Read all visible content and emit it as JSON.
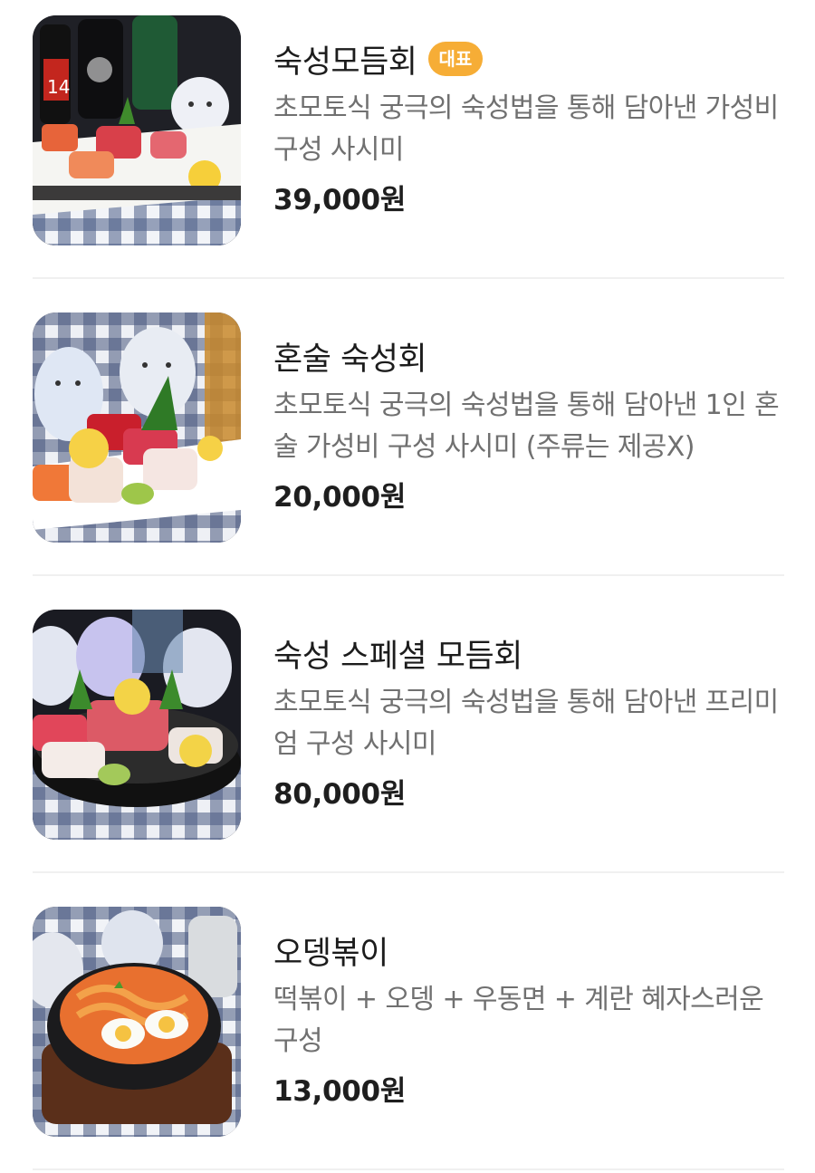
{
  "menu": {
    "items": [
      {
        "title": "숙성모듬회",
        "badge": "대표",
        "description": "초모토식 궁극의 숙성법을 통해 담아낸 가성비 구성 사시미",
        "price": "39,000원",
        "image": "sashimi-platter-photo",
        "image_label": "14"
      },
      {
        "title": "혼술 숙성회",
        "description": "초모토식 궁극의 숙성법을 통해 담아낸 1인 혼술 가성비 구성 사시미 (주류는 제공X)",
        "price": "20,000원",
        "image": "single-sashimi-plate-photo"
      },
      {
        "title": "숙성 스페셜 모듬회",
        "description": "초모토식 궁극의 숙성법을 통해 담아낸 프리미엄 구성 사시미",
        "price": "80,000원",
        "image": "premium-sashimi-platter-photo"
      },
      {
        "title": "오뎅볶이",
        "description": "떡볶이 + 오뎅 + 우동면 + 계란 혜자스러운 구성",
        "price": "13,000원",
        "image": "tteokbokki-pot-photo"
      }
    ]
  },
  "colors": {
    "badge": "#f6ad36",
    "description": "#707070",
    "divider": "#f0f0f0"
  }
}
